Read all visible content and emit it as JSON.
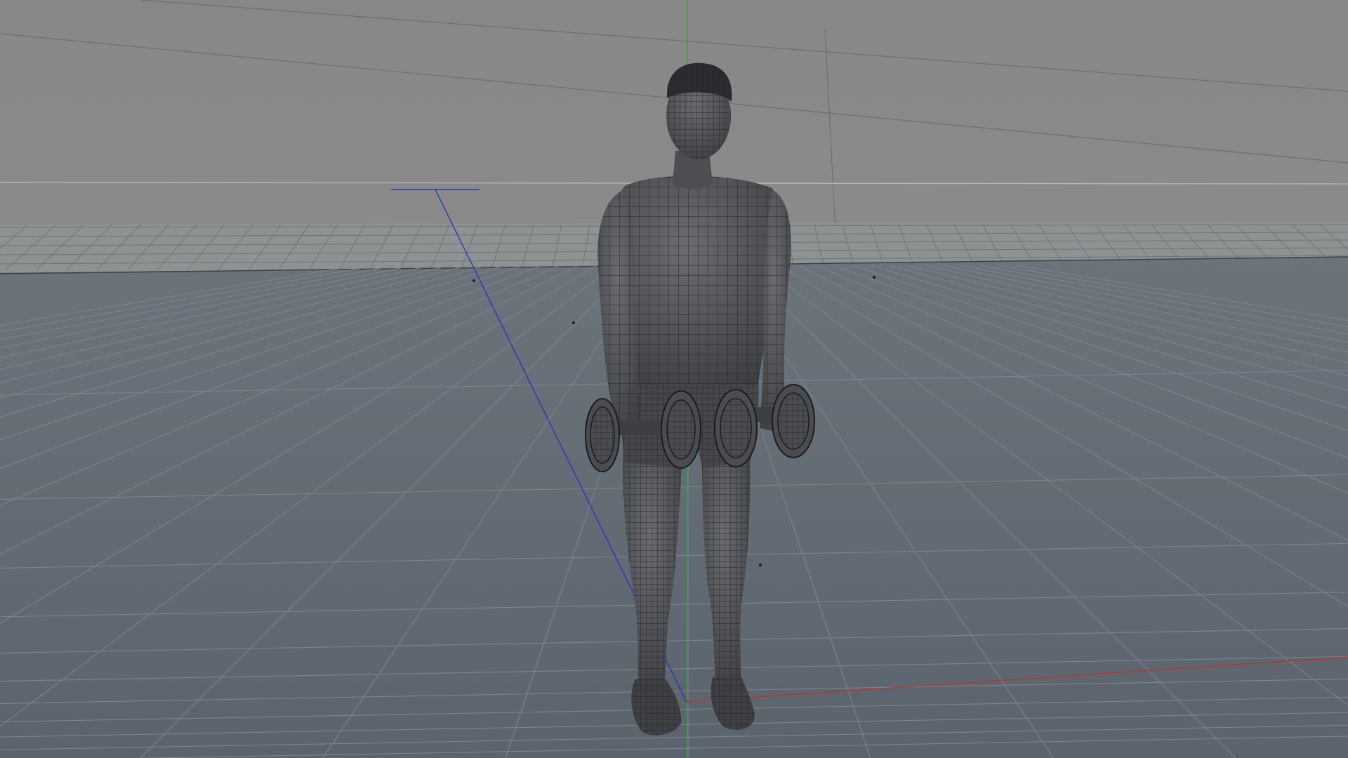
{
  "viewport": {
    "kind": "3d-perspective-viewport",
    "display_mode": "wireframe-shaded",
    "background_sky": "#8b8b8b",
    "floor_color": "#5d6670",
    "grid_line_color": "#7a8590",
    "horizon_band_color": "#8f9293",
    "axis_colors": {
      "x": "#c0302c",
      "y": "#2fa23a",
      "z": "#2f35b8"
    }
  },
  "scene": {
    "figure": "male-figure-holding-dumbbells",
    "figure_color": "#4a4c50",
    "wire_color": "#1c1d20",
    "props": [
      "dumbbell-left",
      "dumbbell-right"
    ]
  },
  "icons": {
    "camera_marker": "camera-target-icon"
  }
}
